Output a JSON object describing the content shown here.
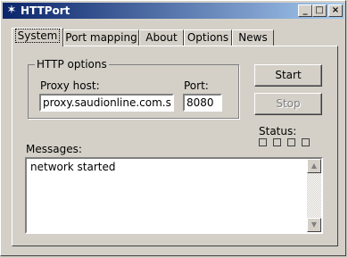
{
  "window": {
    "title": "HTTPort",
    "icon": "star-app-icon",
    "controls": [
      "minimize",
      "maximize",
      "close"
    ]
  },
  "tabs": [
    {
      "label": "System",
      "active": true
    },
    {
      "label": "Port mapping",
      "active": false
    },
    {
      "label": "About",
      "active": false
    },
    {
      "label": "Options",
      "active": false
    },
    {
      "label": "News",
      "active": false
    }
  ],
  "http_options": {
    "group_label": "HTTP options",
    "proxy_host_label": "Proxy host:",
    "proxy_host_value": "proxy.saudionline.com.s",
    "port_label": "Port:",
    "port_value": "8080"
  },
  "buttons": {
    "start": "Start",
    "stop": "Stop"
  },
  "status": {
    "label": "Status:",
    "indicators": 4
  },
  "messages": {
    "label": "Messages:",
    "lines": [
      "network started"
    ]
  }
}
